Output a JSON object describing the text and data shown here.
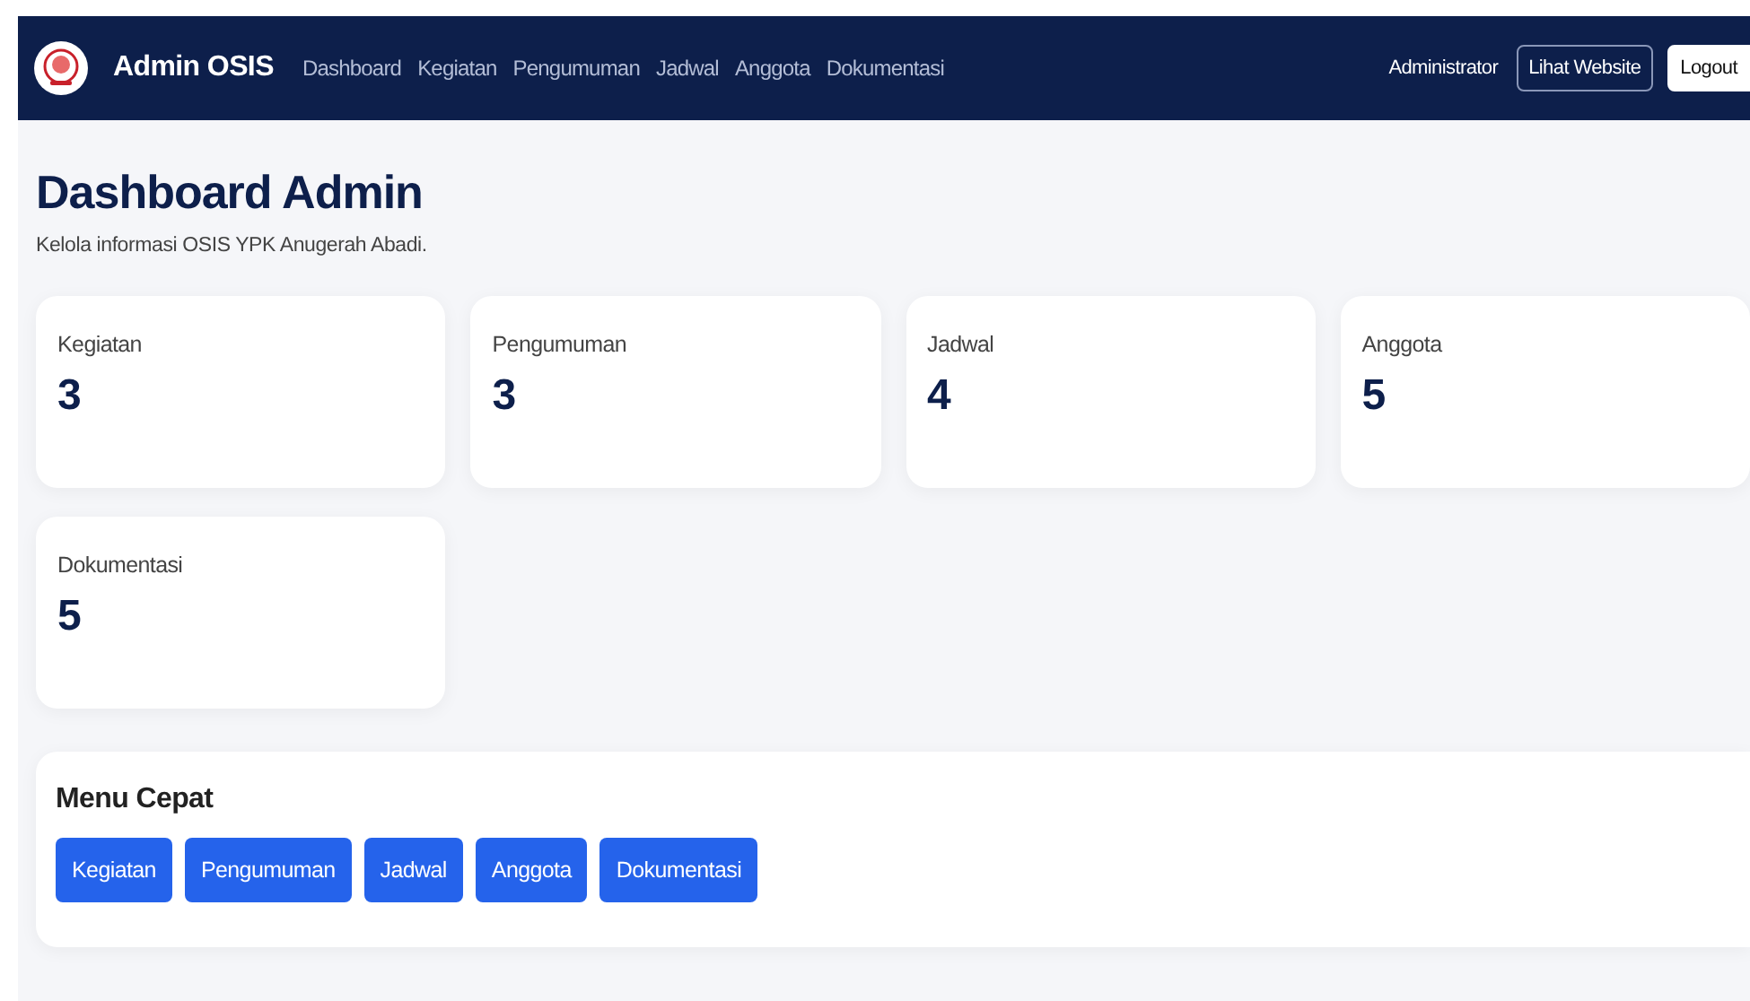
{
  "navbar": {
    "brand": "Admin OSIS",
    "links": [
      {
        "label": "Dashboard"
      },
      {
        "label": "Kegiatan"
      },
      {
        "label": "Pengumuman"
      },
      {
        "label": "Jadwal"
      },
      {
        "label": "Anggota"
      },
      {
        "label": "Dokumentasi"
      }
    ],
    "user": "Administrator",
    "buttons": [
      {
        "label": "Lihat Website",
        "kind": "outline"
      },
      {
        "label": "Logout",
        "kind": "solid"
      }
    ]
  },
  "header": {
    "title": "Dashboard Admin",
    "subtitle": "Kelola informasi OSIS YPK Anugerah Abadi."
  },
  "stats": [
    {
      "label": "Kegiatan",
      "value": "3"
    },
    {
      "label": "Pengumuman",
      "value": "3"
    },
    {
      "label": "Jadwal",
      "value": "4"
    },
    {
      "label": "Anggota",
      "value": "5"
    },
    {
      "label": "Dokumentasi",
      "value": "5"
    }
  ],
  "quick_menu": {
    "title": "Menu Cepat",
    "buttons": [
      "Kegiatan",
      "Pengumuman",
      "Jadwal",
      "Anggota",
      "Dokumentasi"
    ]
  }
}
